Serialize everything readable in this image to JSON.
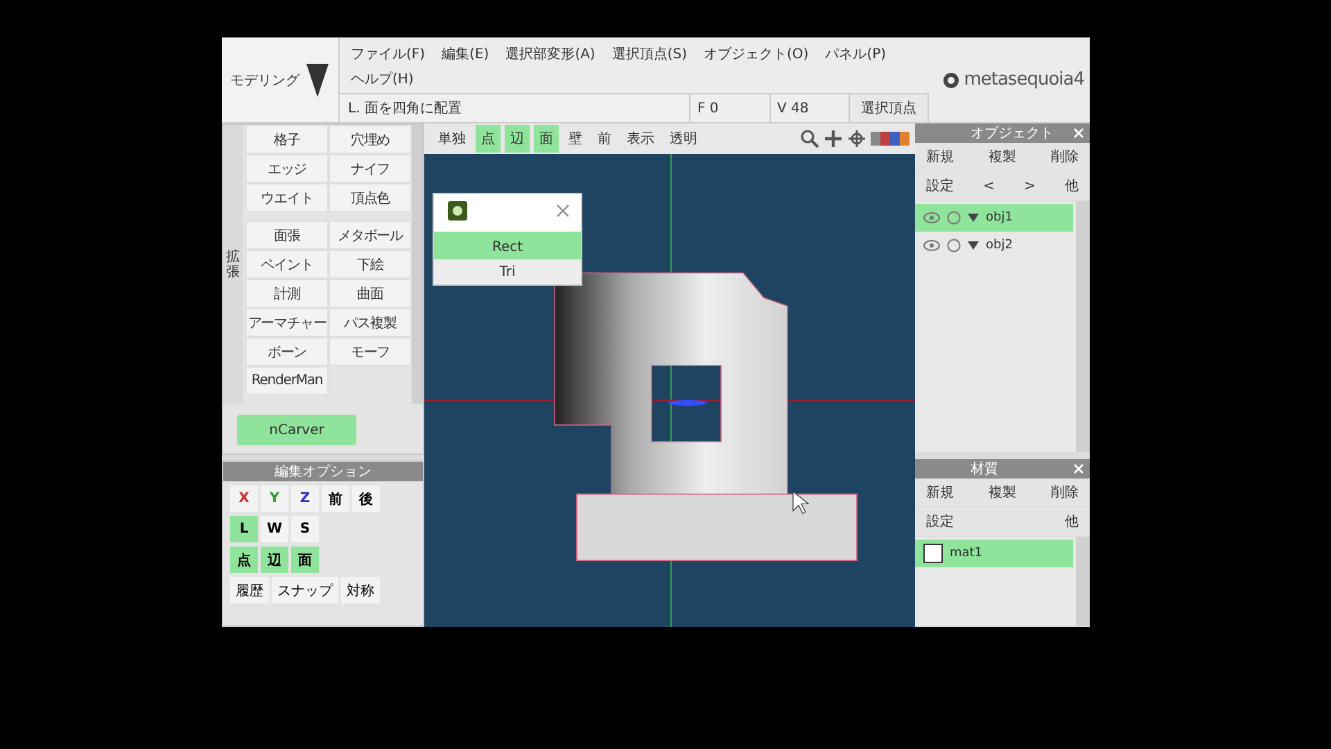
{
  "mode_button": {
    "label": "モデリング"
  },
  "menu_rows": [
    [
      "ファイル(F)",
      "編集(E)",
      "選択部変形(A)",
      "選択頂点(S)",
      "オブジェクト(O)",
      "パネル(P)"
    ],
    [
      "ヘルプ(H)"
    ]
  ],
  "command_bar": {
    "prompt": "L. 面を四角に配置",
    "fields": [
      "F 0",
      "V 48"
    ],
    "button": "選択頂点"
  },
  "logo": {
    "text": "metasequoia4"
  },
  "tool_panel": {
    "section_label": "拡張",
    "groups": [
      [
        {
          "label": "格子",
          "selected": false
        },
        {
          "label": "穴埋め",
          "selected": false
        },
        {
          "label": "エッジ",
          "selected": false
        },
        {
          "label": "ナイフ",
          "selected": false
        },
        {
          "label": "ウエイト",
          "selected": false
        },
        {
          "label": "頂点色",
          "selected": false
        }
      ],
      [
        {
          "label": "面張",
          "selected": false
        },
        {
          "label": "メタボール",
          "selected": false
        },
        {
          "label": "ペイント",
          "selected": false
        },
        {
          "label": "下絵",
          "selected": false
        },
        {
          "label": "計測",
          "selected": false
        },
        {
          "label": "曲面",
          "selected": false
        },
        {
          "label": "アーマチャー",
          "selected": false
        },
        {
          "label": "パス複製",
          "selected": false
        },
        {
          "label": "ボーン",
          "selected": false
        },
        {
          "label": "モーフ",
          "selected": false
        },
        {
          "label": "RenderMan",
          "selected": false
        }
      ]
    ],
    "plugin": {
      "label": "nCarver",
      "selected": true
    }
  },
  "edit_options": {
    "title": "編集オプション",
    "rows": [
      [
        {
          "label": "X",
          "selected": false,
          "color": "#d03030"
        },
        {
          "label": "Y",
          "selected": false,
          "color": "#30a030"
        },
        {
          "label": "Z",
          "selected": false,
          "color": "#3030c0"
        },
        {
          "label": "前",
          "selected": false
        },
        {
          "label": "後",
          "selected": false
        }
      ],
      [
        {
          "label": "L",
          "selected": true
        },
        {
          "label": "W",
          "selected": false
        },
        {
          "label": "S",
          "selected": false
        }
      ],
      [
        {
          "label": "点",
          "selected": true
        },
        {
          "label": "辺",
          "selected": true
        },
        {
          "label": "面",
          "selected": true
        }
      ]
    ],
    "footer_buttons": [
      "履歴",
      "スナップ",
      "対称"
    ]
  },
  "view_toolbar": [
    {
      "label": "単独",
      "selected": false
    },
    {
      "label": "点",
      "selected": true
    },
    {
      "label": "辺",
      "selected": true
    },
    {
      "label": "面",
      "selected": true
    },
    {
      "label": "壁",
      "selected": false
    },
    {
      "label": "前",
      "selected": false
    },
    {
      "label": "表示",
      "selected": false
    },
    {
      "label": "透明",
      "selected": false
    }
  ],
  "popup": {
    "items": [
      {
        "label": "Rect",
        "selected": true
      },
      {
        "label": "Tri",
        "selected": false
      }
    ]
  },
  "objects_panel": {
    "title": "オブジェクト",
    "buttons": [
      [
        "新規",
        "複製",
        "削除"
      ],
      [
        "設定",
        "<",
        ">",
        "他"
      ]
    ],
    "items": [
      {
        "name": "obj1",
        "selected": true
      },
      {
        "name": "obj2",
        "selected": false
      }
    ]
  },
  "materials_panel": {
    "title": "材質",
    "buttons": [
      [
        "新規",
        "複製",
        "削除"
      ],
      [
        "設定",
        "他"
      ]
    ],
    "items": [
      {
        "name": "mat1",
        "selected": true
      }
    ]
  }
}
